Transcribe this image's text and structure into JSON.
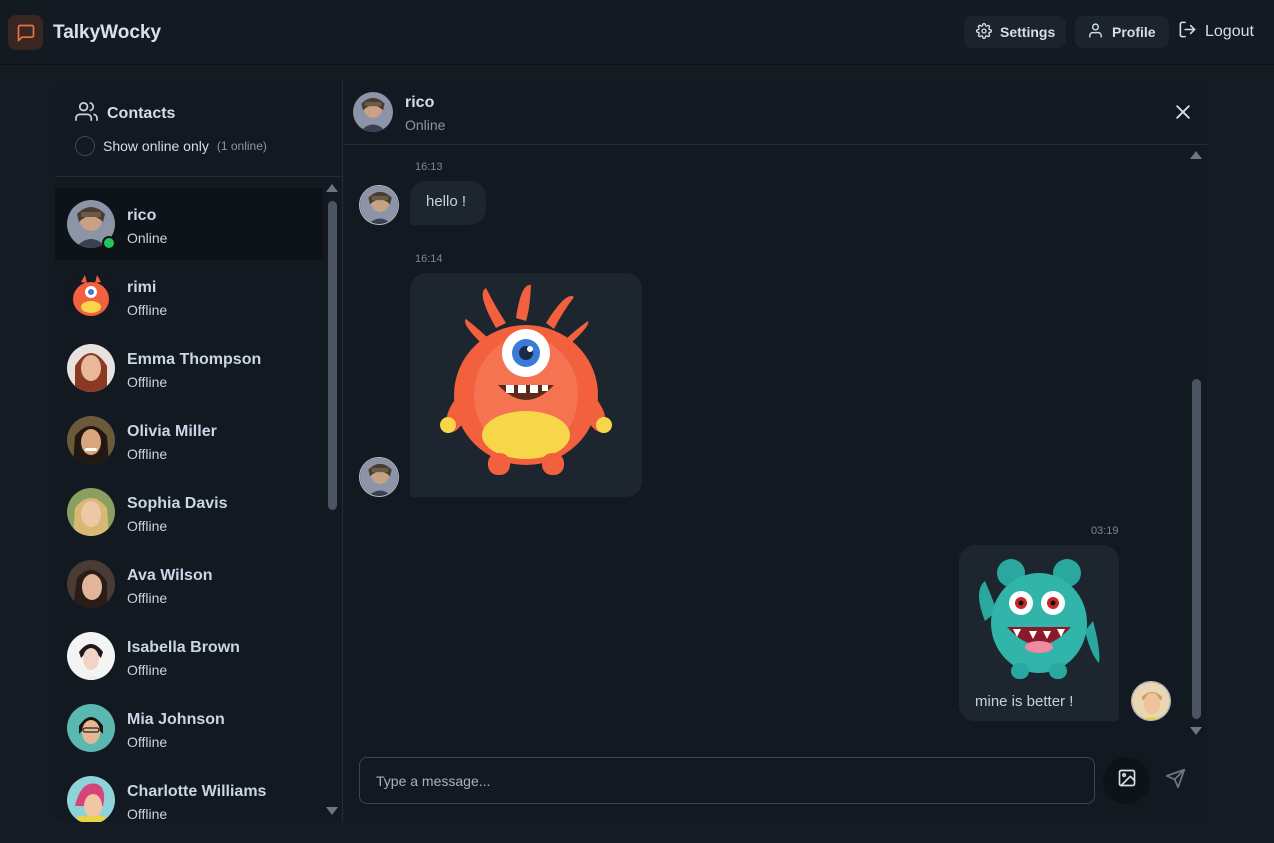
{
  "app": {
    "brand": "TalkyWocky",
    "settings_label": "Settings",
    "profile_label": "Profile",
    "logout_label": "Logout"
  },
  "sidebar": {
    "title": "Contacts",
    "online_toggle_label": "Show online only",
    "online_count": "(1 online)",
    "contacts": [
      {
        "name": "rico",
        "status": "Online"
      },
      {
        "name": "rimi",
        "status": "Offline"
      },
      {
        "name": "Emma Thompson",
        "status": "Offline"
      },
      {
        "name": "Olivia Miller",
        "status": "Offline"
      },
      {
        "name": "Sophia Davis",
        "status": "Offline"
      },
      {
        "name": "Ava Wilson",
        "status": "Offline"
      },
      {
        "name": "Isabella Brown",
        "status": "Offline"
      },
      {
        "name": "Mia Johnson",
        "status": "Offline"
      },
      {
        "name": "Charlotte Williams",
        "status": "Offline"
      }
    ]
  },
  "chat": {
    "name": "rico",
    "status": "Online",
    "messages": [
      {
        "time": "16:13",
        "text": "hello !"
      },
      {
        "time": "16:14",
        "text": ""
      },
      {
        "time": "03:19",
        "text": "mine is better !"
      }
    ],
    "input_placeholder": "Type a message..."
  },
  "colors": {
    "accent": "#e8734a",
    "online": "#22c55e",
    "background": "#141b23"
  }
}
